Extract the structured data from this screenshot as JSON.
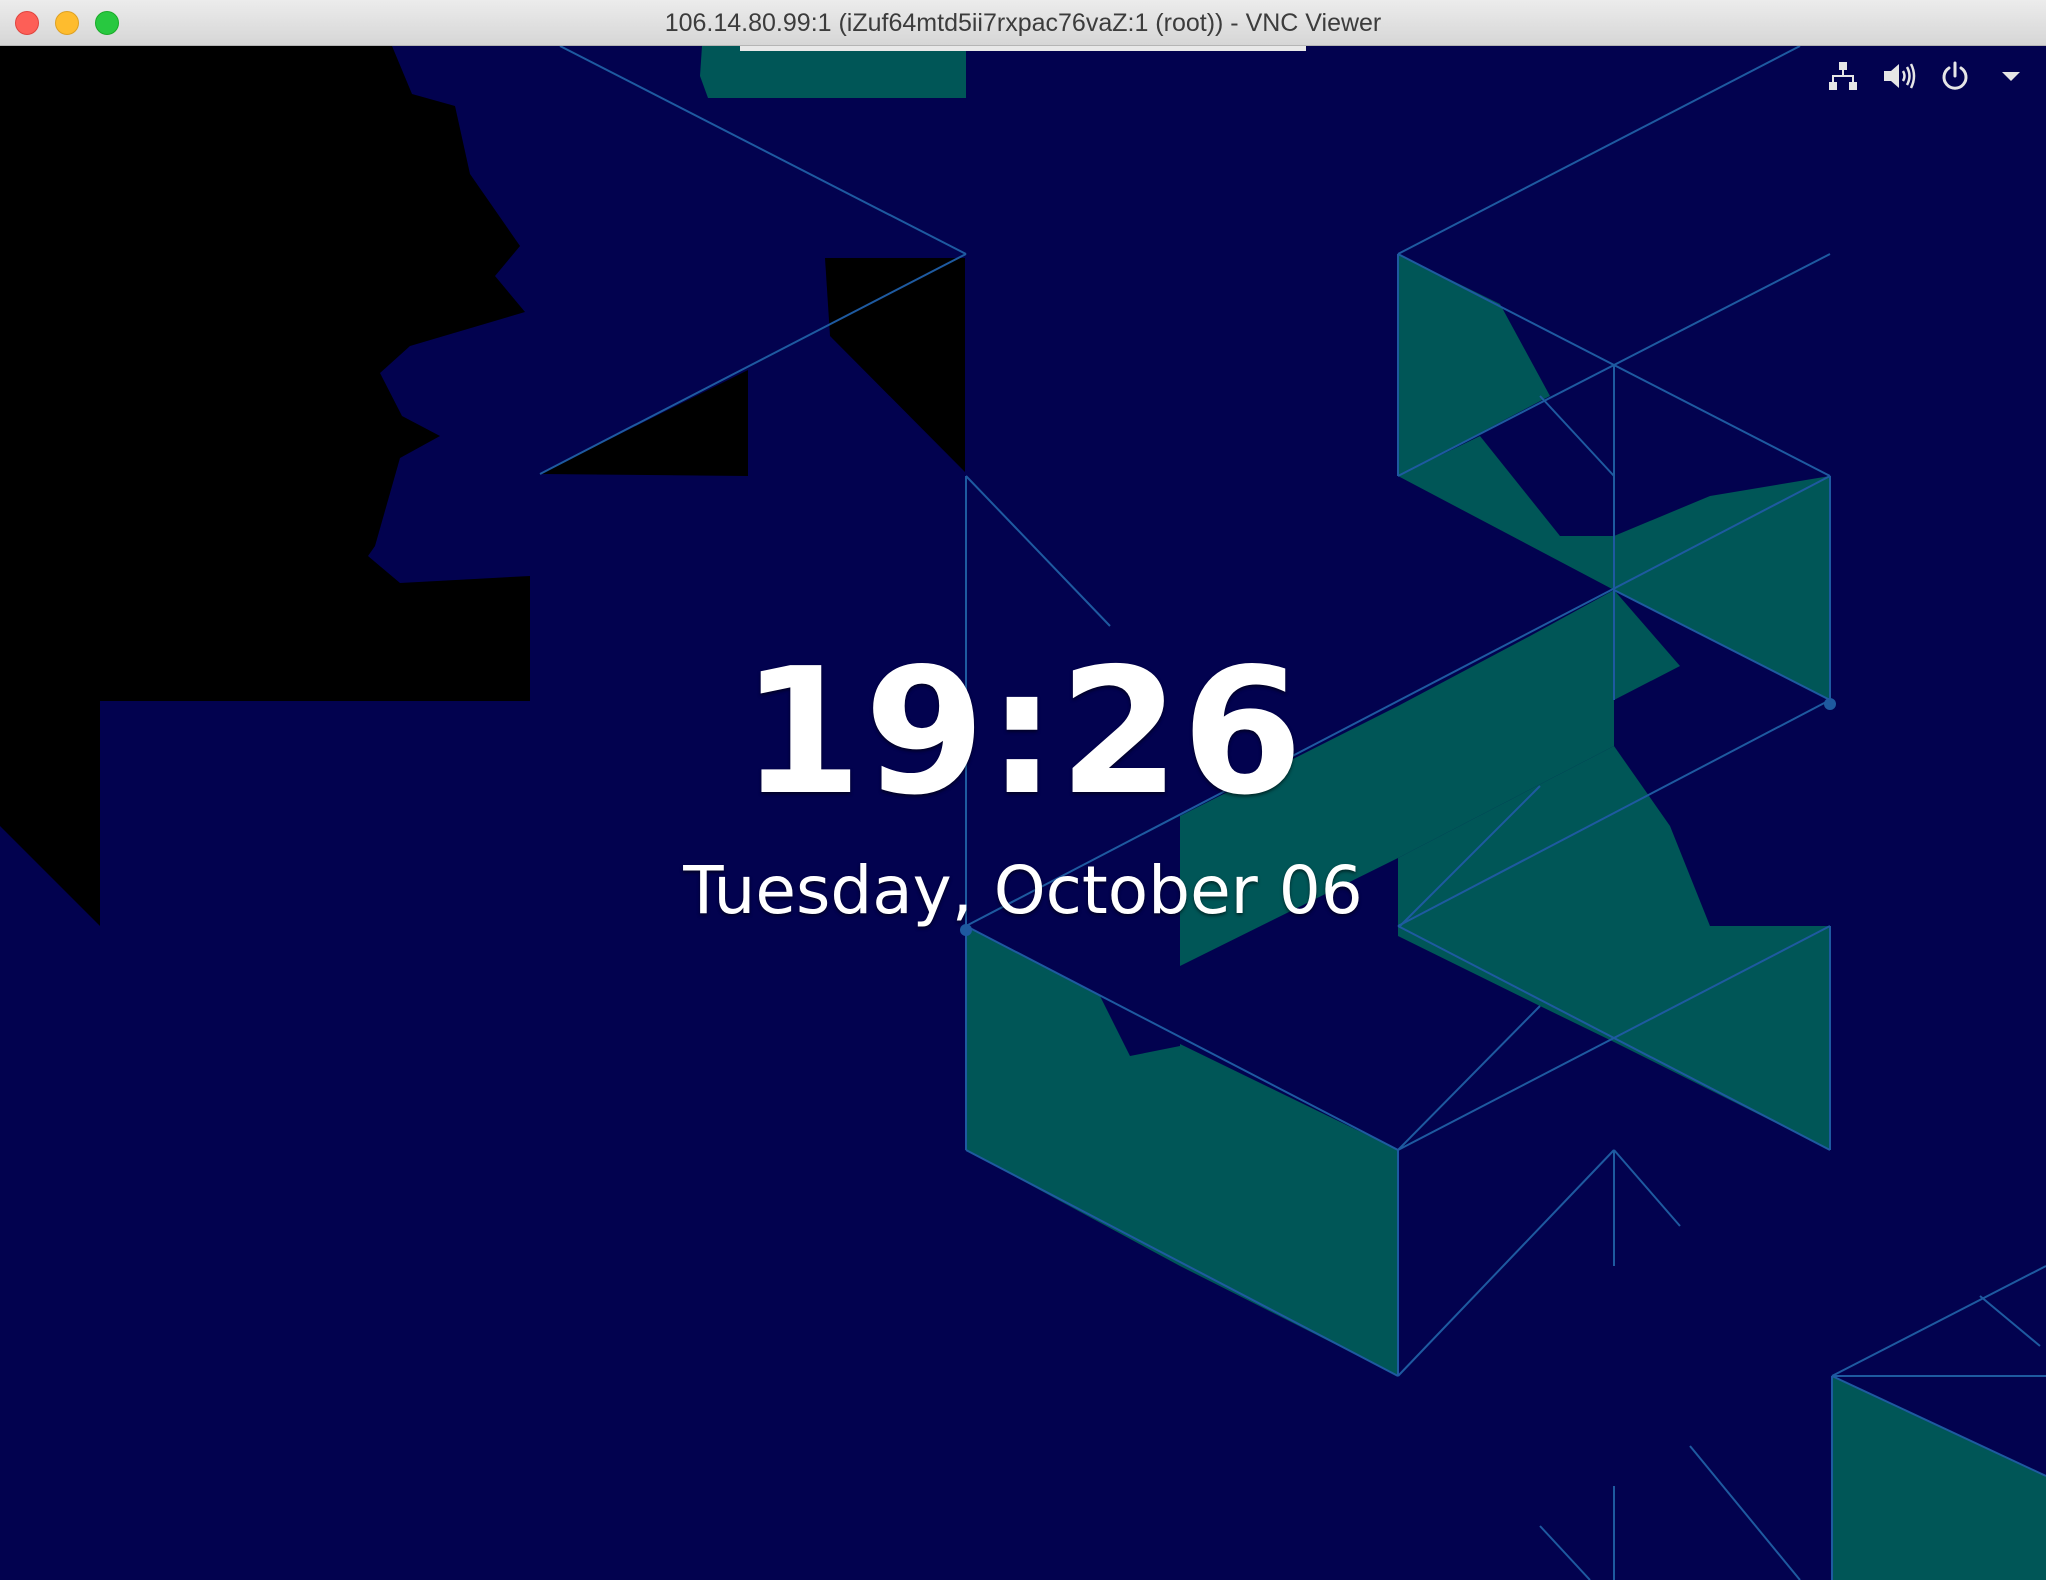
{
  "window": {
    "title": "106.14.80.99:1 (iZuf64mtd5ii7rxpac76vaZ:1 (root)) - VNC Viewer"
  },
  "status_area": {
    "icons": [
      "network-icon",
      "volume-icon",
      "power-icon",
      "chevron-down-icon"
    ]
  },
  "lock_screen": {
    "time": "19:26",
    "date": "Tuesday, October 06"
  },
  "colors": {
    "background": "#02024f",
    "teal": "#005657",
    "black_region": "#000000",
    "line": "#1e5aa0"
  }
}
